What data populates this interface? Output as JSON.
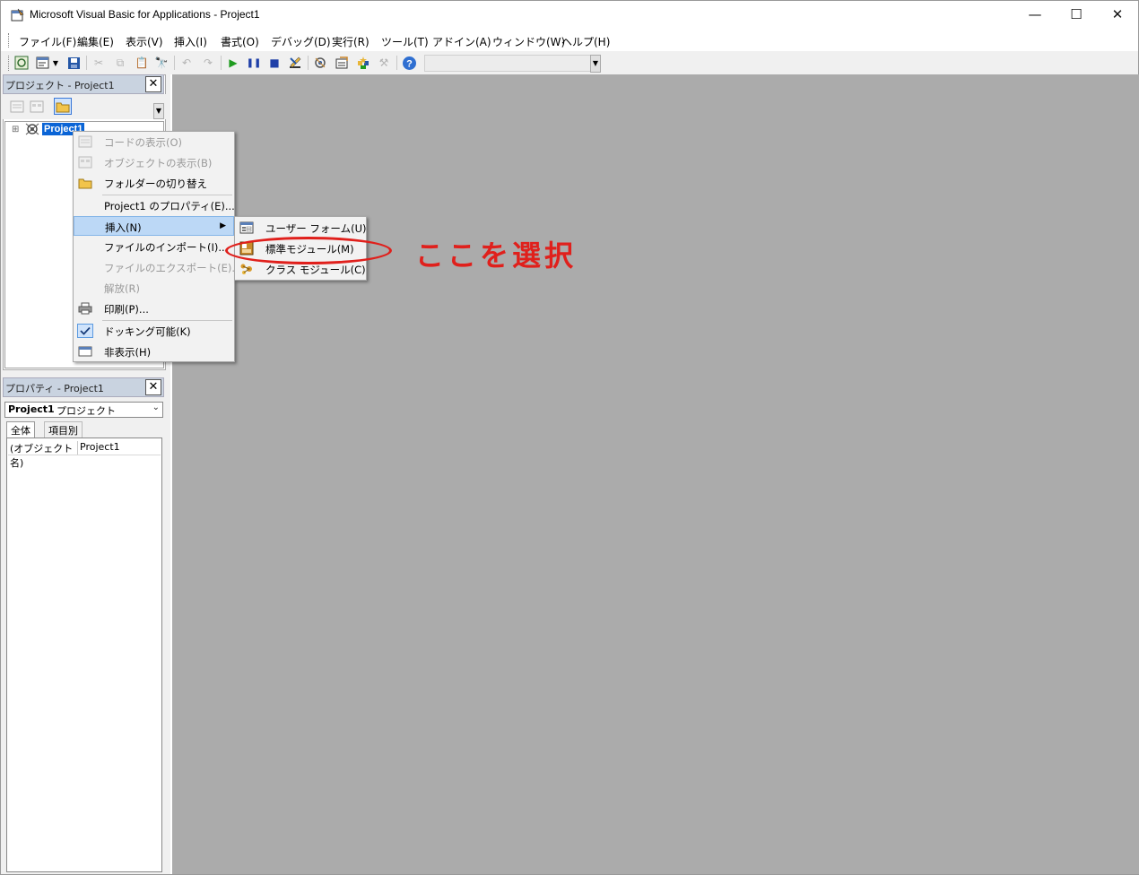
{
  "window": {
    "title": "Microsoft Visual Basic for Applications - Project1",
    "minimize": "—",
    "maximize": "☐",
    "close": "✕"
  },
  "menubar": [
    "ファイル(F)",
    "編集(E)",
    "表示(V)",
    "挿入(I)",
    "書式(O)",
    "デバッグ(D)",
    "実行(R)",
    "ツール(T)",
    "アドイン(A)",
    "ウィンドウ(W)",
    "ヘルプ(H)"
  ],
  "toolbar": {
    "icons": [
      "excel-view-icon",
      "insert-object-icon",
      "dropdown-icon",
      "save-icon",
      "cut-icon",
      "copy-icon",
      "paste-icon",
      "find-icon",
      "undo-icon",
      "redo-icon",
      "run-icon",
      "break-icon",
      "reset-icon",
      "design-mode-icon",
      "project-explorer-icon",
      "properties-window-icon",
      "object-browser-icon",
      "toolbox-icon",
      "help-icon"
    ]
  },
  "project_pane": {
    "title": "プロジェクト - Project1",
    "close": "✕",
    "tree_root": "Project1",
    "expand": "⊞"
  },
  "properties_pane": {
    "title": "プロパティ - Project1",
    "close": "✕",
    "object_name": "Project1",
    "object_kind": "プロジェクト",
    "tabs": [
      "全体",
      "項目別"
    ],
    "row_key": "(オブジェクト名)",
    "row_value": "Project1"
  },
  "context_menu": {
    "items": [
      {
        "label": "コードの表示(O)",
        "disabled": true
      },
      {
        "label": "オブジェクトの表示(B)",
        "disabled": true
      },
      {
        "label": "フォルダーの切り替え",
        "disabled": false
      },
      {
        "label": "Project1 のプロパティ(E)...",
        "disabled": false
      },
      {
        "label": "挿入(N)",
        "disabled": false,
        "highlighted": true
      },
      {
        "label": "ファイルのインポート(I)...",
        "disabled": false
      },
      {
        "label": "ファイルのエクスポート(E)...",
        "disabled": true
      },
      {
        "label": "解放(R)",
        "disabled": true
      },
      {
        "label": "印刷(P)...",
        "disabled": false
      },
      {
        "label": "ドッキング可能(K)",
        "disabled": false,
        "checked": true
      },
      {
        "label": "非表示(H)",
        "disabled": false
      }
    ]
  },
  "submenu": {
    "items": [
      "ユーザー フォーム(U)",
      "標準モジュール(M)",
      "クラス モジュール(C)"
    ]
  },
  "annotation": {
    "text": "ここを選択",
    "color": "#e0201c"
  }
}
